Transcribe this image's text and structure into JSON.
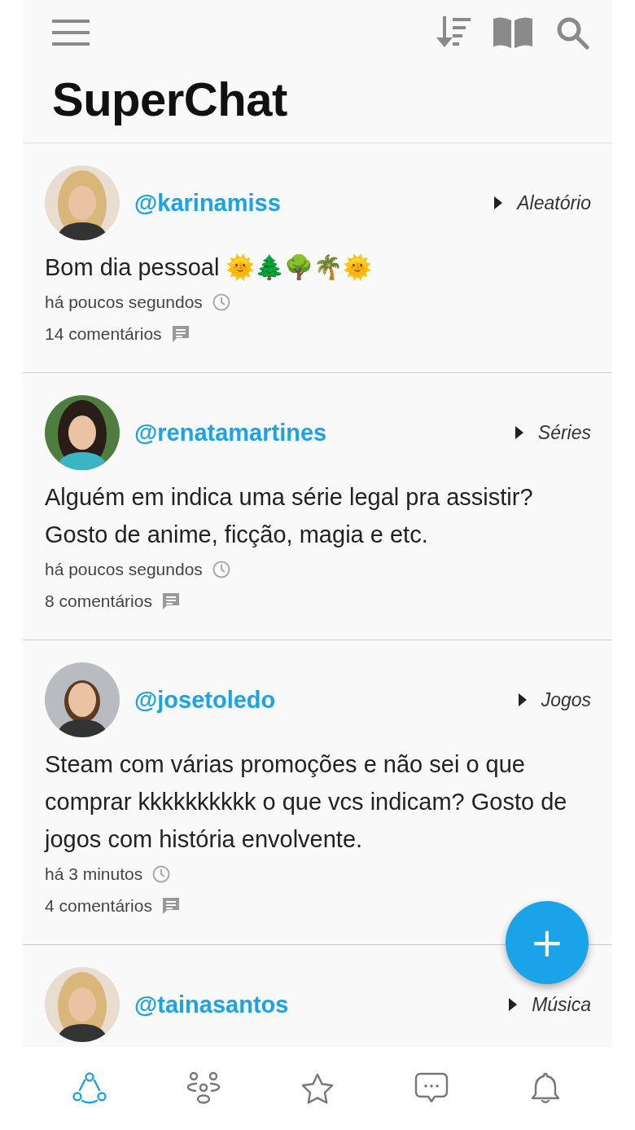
{
  "app": {
    "title": "SuperChat"
  },
  "posts": [
    {
      "username": "@karinamiss",
      "category": "Aleatório",
      "text": "Bom dia pessoal 🌞🌲🌳🌴🌞",
      "time": "há poucos segundos",
      "comments": "14 comentários"
    },
    {
      "username": "@renatamartines",
      "category": "Séries",
      "text": "Alguém em indica uma série legal pra assistir? Gosto de anime, ficção, magia e etc.",
      "time": "há poucos segundos",
      "comments": "8 comentários"
    },
    {
      "username": "@josetoledo",
      "category": "Jogos",
      "text": "Steam com várias promoções e não sei o que comprar kkkkkkkkkk o que vcs indicam? Gosto de jogos com história envolvente.",
      "time": "há 3 minutos",
      "comments": "4 comentários"
    },
    {
      "username": "@tainasantos",
      "category": "Música"
    }
  ],
  "fab": {
    "label": "+"
  },
  "bottom_nav": [
    {
      "kind": "community",
      "selected": true
    },
    {
      "kind": "groups",
      "selected": false
    },
    {
      "kind": "favorites",
      "selected": false
    },
    {
      "kind": "messages",
      "selected": false
    },
    {
      "kind": "notifications",
      "selected": false
    }
  ]
}
